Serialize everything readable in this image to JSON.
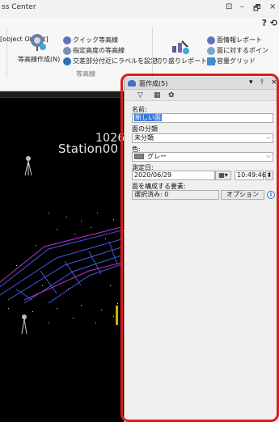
{
  "window": {
    "title": "ss Center",
    "controls": {
      "restore": "⊡",
      "minimize": "–",
      "pin": "🗗",
      "close": "×"
    },
    "help": "? ⟲"
  },
  "ribbon": {
    "contour_create": {
      "label": "等高線作成(N)",
      "icon": "contour-pin-icon"
    },
    "quick_contour": {
      "label": "クイック等高線"
    },
    "specified_height": {
      "label": "指定高度の等高線"
    },
    "cross_label": {
      "label": "交差部分付近にラベルを設定"
    },
    "group_contour": {
      "label": "等高線"
    },
    "cutfill_report": {
      "label": "切り盛りレポート(E)"
    },
    "surface_report": {
      "label": "面情報レポート"
    },
    "surface_point": {
      "label": "面に対するポイン"
    },
    "volume_grid": {
      "label": "容量グリッド"
    },
    "group_report": {
      "label": "面 他"
    },
    "left_clip": {
      "label": "の"
    }
  },
  "viewport": {
    "station_label": "Station00",
    "station_overlay": "1026(t"
  },
  "panel": {
    "title": "面作成(5)",
    "head_buttons": {
      "dropdown": "▾",
      "pin": "⫯",
      "close": "×"
    },
    "toolbar": {
      "filter": "▽",
      "table": "▦",
      "settings": "✿"
    },
    "name_label": "名前:",
    "name_value": "新しい面",
    "class_label": "面の分類",
    "class_value": "未分類",
    "color_label": "色:",
    "color_value": "グレー",
    "color_hex": "#808080",
    "date_label": "測定日:",
    "date_value": "2020/06/29",
    "time_value": "10:49:46",
    "elements_label": "面を構成する要素:",
    "selected_text": "選択済み: 0",
    "option_button": "オプション",
    "info": "i"
  },
  "colors": {
    "highlight": "#e01b1b",
    "viewport_bg": "#000000",
    "selection": "#3a78d8"
  }
}
